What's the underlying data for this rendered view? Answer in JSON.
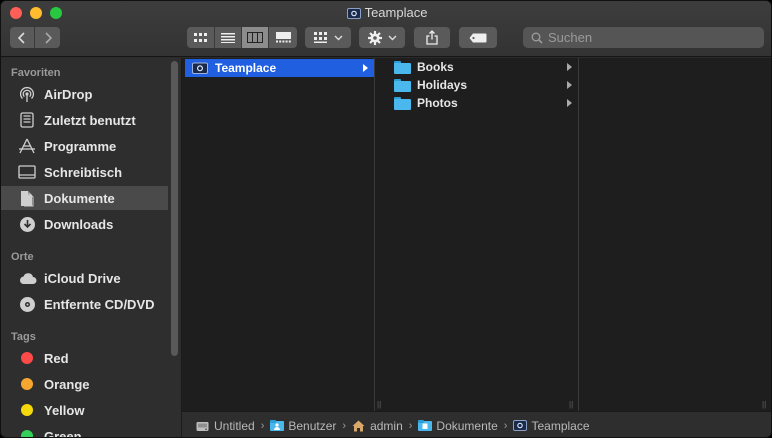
{
  "window": {
    "title": "Teamplace"
  },
  "toolbar": {
    "back_icon": "chevron-left-icon",
    "forward_icon": "chevron-right-icon",
    "view_modes": [
      "icon-view",
      "list-view",
      "column-view",
      "gallery-view"
    ],
    "active_view": "column-view",
    "group_icon": "group-icon",
    "action_icon": "gear-icon",
    "share_icon": "share-icon",
    "tag_icon": "tag-icon",
    "search_placeholder": "Suchen"
  },
  "sidebar": {
    "sections": [
      {
        "heading": "Favoriten",
        "items": [
          {
            "label": "AirDrop",
            "icon": "airdrop-icon"
          },
          {
            "label": "Zuletzt benutzt",
            "icon": "recents-icon"
          },
          {
            "label": "Programme",
            "icon": "applications-icon"
          },
          {
            "label": "Schreibtisch",
            "icon": "desktop-icon"
          },
          {
            "label": "Dokumente",
            "icon": "documents-icon",
            "selected": true
          },
          {
            "label": "Downloads",
            "icon": "downloads-icon"
          }
        ]
      },
      {
        "heading": "Orte",
        "items": [
          {
            "label": "iCloud Drive",
            "icon": "cloud-icon"
          },
          {
            "label": "Entfernte CD/DVD",
            "icon": "disc-icon"
          }
        ]
      },
      {
        "heading": "Tags",
        "items": [
          {
            "label": "Red",
            "color": "#ff4a4a"
          },
          {
            "label": "Orange",
            "color": "#f7a72f"
          },
          {
            "label": "Yellow",
            "color": "#f5d90a"
          },
          {
            "label": "Green",
            "color": "#35d05a"
          }
        ]
      }
    ]
  },
  "columns": [
    {
      "items": [
        {
          "label": "Teamplace",
          "icon": "teamplace-icon",
          "selected": true,
          "has_children": true
        }
      ]
    },
    {
      "items": [
        {
          "label": "Books",
          "icon": "folder-icon",
          "has_children": true
        },
        {
          "label": "Holidays",
          "icon": "folder-icon",
          "has_children": true
        },
        {
          "label": "Photos",
          "icon": "folder-icon",
          "has_children": true
        }
      ]
    },
    {
      "items": []
    }
  ],
  "pathbar": [
    {
      "label": "Untitled",
      "icon": "drive-icon"
    },
    {
      "label": "Benutzer",
      "icon": "users-folder-icon"
    },
    {
      "label": "admin",
      "icon": "home-icon"
    },
    {
      "label": "Dokumente",
      "icon": "folder-icon"
    },
    {
      "label": "Teamplace",
      "icon": "teamplace-icon"
    }
  ],
  "colors": {
    "selection": "#1f5fe0",
    "folder": "#4ab8ec"
  }
}
